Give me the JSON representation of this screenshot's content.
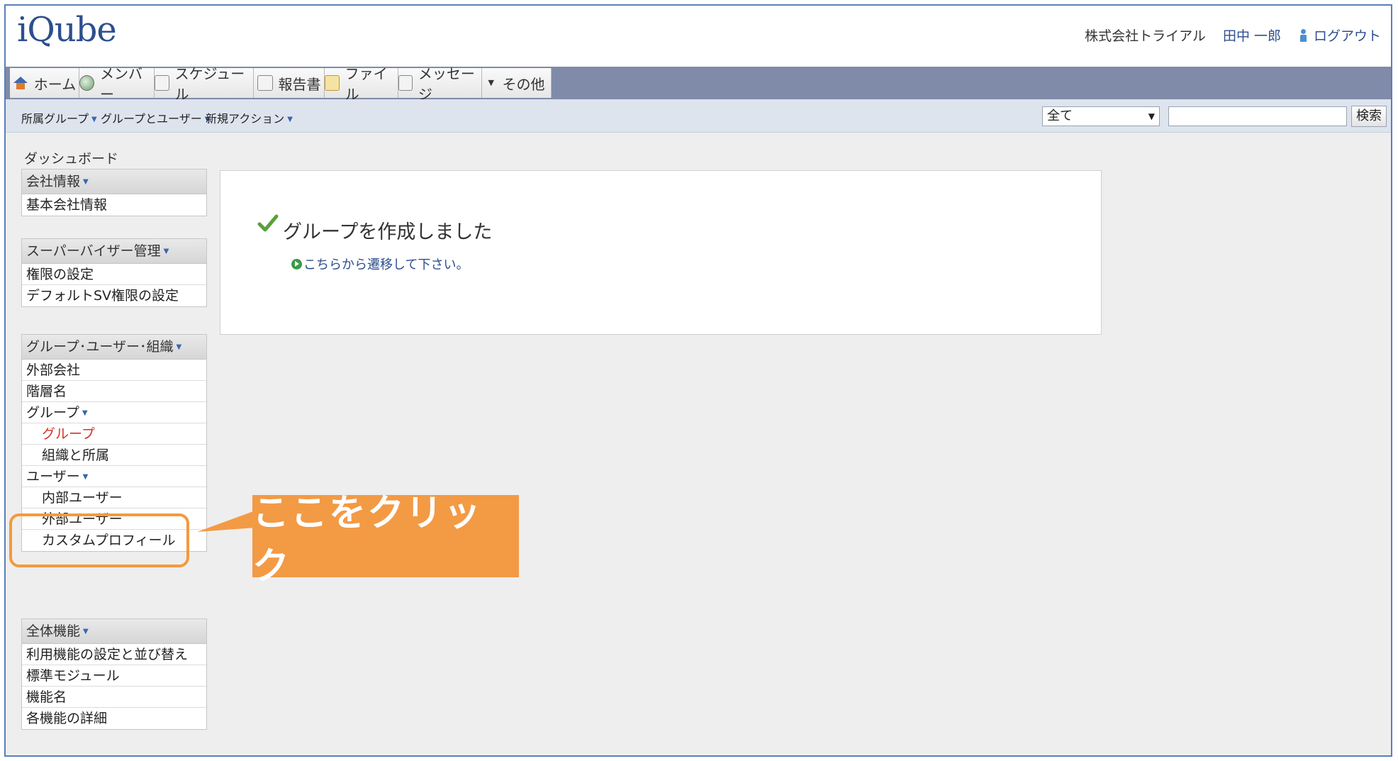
{
  "header": {
    "logo": "iQube",
    "company": "株式会社トライアル",
    "user": "田中 一郎",
    "logout": "ログアウト"
  },
  "tabs": [
    {
      "label": "ホーム",
      "icon": "home-icon"
    },
    {
      "label": "メンバー",
      "icon": "member-icon"
    },
    {
      "label": "スケジュール",
      "icon": "schedule-icon"
    },
    {
      "label": "報告書",
      "icon": "report-icon"
    },
    {
      "label": "ファイル",
      "icon": "file-icon"
    },
    {
      "label": "メッセージ",
      "icon": "message-icon"
    },
    {
      "label": "その他",
      "icon": "dropdown-icon"
    }
  ],
  "subnav": {
    "groups": "所属グループ",
    "group_user": "グループとユーザー",
    "new_action": "新規アクション",
    "filter_value": "全て",
    "search_button": "検索"
  },
  "sidebar": {
    "dashboard": "ダッシュボード",
    "company": {
      "title": "会社情報",
      "items": [
        "基本会社情報"
      ]
    },
    "supervisor": {
      "title": "スーパーバイザー管理",
      "items": [
        "権限の設定",
        "デフォルトSV権限の設定"
      ]
    },
    "org": {
      "title": "グループ･ユーザー･組織",
      "items": [
        "外部会社",
        "階層名",
        "グループ",
        "グループ",
        "組織と所属",
        "ユーザー",
        "内部ユーザー",
        "外部ユーザー",
        "カスタムプロフィール"
      ]
    },
    "features": {
      "title": "全体機能",
      "items": [
        "利用機能の設定と並び替え",
        "標準モジュール",
        "機能名",
        "各機能の詳細"
      ]
    }
  },
  "main": {
    "success_message": "グループを作成しました",
    "redirect_link": "こちらから遷移して下さい。"
  },
  "annotation": {
    "callout": "ここをクリック",
    "color": "#f39a45"
  }
}
